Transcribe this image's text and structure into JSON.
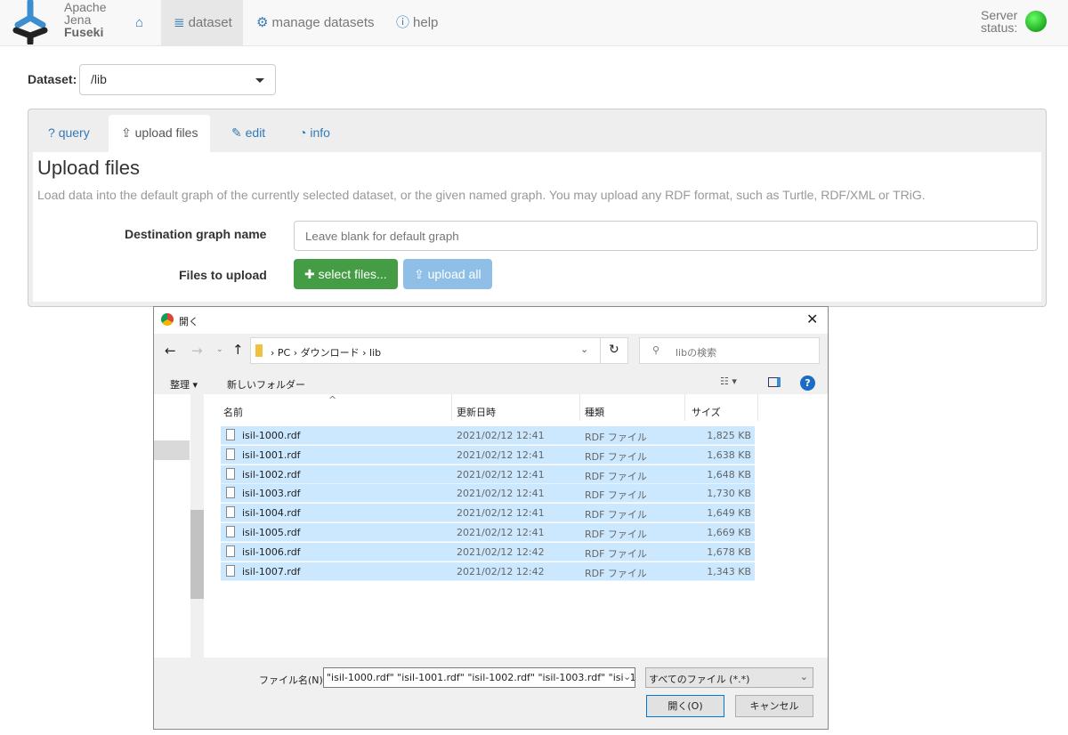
{
  "nav": {
    "brand": [
      "Apache",
      "Jena",
      "Fuseki"
    ],
    "items": [
      "dataset",
      "manage datasets",
      "help"
    ],
    "status": [
      "Server",
      "status:"
    ],
    "status_color": "#22aa22"
  },
  "dataset": {
    "label": "Dataset:",
    "value": "/lib"
  },
  "tabs": [
    "query",
    "upload files",
    "edit",
    "info"
  ],
  "upload": {
    "title": "Upload files",
    "desc": "Load data into the default graph of the currently selected dataset, or the given named graph. You may upload any RDF format, such as Turtle, RDF/XML or TRiG.",
    "dest_label": "Destination graph name",
    "dest_placeholder": "Leave blank for default graph",
    "files_label": "Files to upload",
    "select": "select files...",
    "upload_all": "upload all"
  },
  "dialog": {
    "title": "開く",
    "path": [
      "PC",
      "ダウンロード",
      "lib"
    ],
    "search_placeholder": "libの検索",
    "organize": "整理 ▾",
    "new_folder": "新しいフォルダー",
    "columns": [
      "名前",
      "更新日時",
      "種類",
      "サイズ"
    ],
    "files": [
      {
        "name": "isil-1000.rdf",
        "date": "2021/02/12 12:41",
        "type": "RDF ファイル",
        "size": "1,825 KB"
      },
      {
        "name": "isil-1001.rdf",
        "date": "2021/02/12 12:41",
        "type": "RDF ファイル",
        "size": "1,638 KB"
      },
      {
        "name": "isil-1002.rdf",
        "date": "2021/02/12 12:41",
        "type": "RDF ファイル",
        "size": "1,648 KB"
      },
      {
        "name": "isil-1003.rdf",
        "date": "2021/02/12 12:41",
        "type": "RDF ファイル",
        "size": "1,730 KB"
      },
      {
        "name": "isil-1004.rdf",
        "date": "2021/02/12 12:41",
        "type": "RDF ファイル",
        "size": "1,649 KB"
      },
      {
        "name": "isil-1005.rdf",
        "date": "2021/02/12 12:41",
        "type": "RDF ファイル",
        "size": "1,669 KB"
      },
      {
        "name": "isil-1006.rdf",
        "date": "2021/02/12 12:42",
        "type": "RDF ファイル",
        "size": "1,678 KB"
      },
      {
        "name": "isil-1007.rdf",
        "date": "2021/02/12 12:42",
        "type": "RDF ファイル",
        "size": "1,343 KB"
      }
    ],
    "filename_label": "ファイル名(N):",
    "filename_value": "\"isil-1000.rdf\" \"isil-1001.rdf\" \"isil-1002.rdf\" \"isil-1003.rdf\" \"isil-1",
    "filter": "すべてのファイル (*.*)",
    "open": "開く(O)",
    "cancel": "キャンセル"
  }
}
